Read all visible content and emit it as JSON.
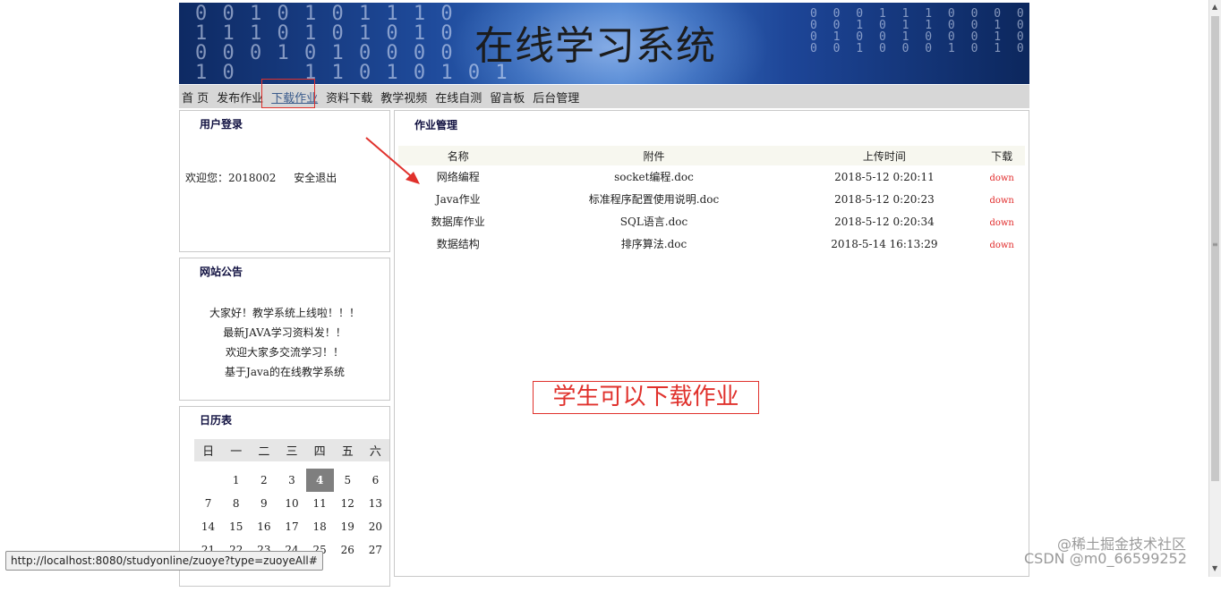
{
  "banner": {
    "title": "在线学习系统",
    "binary_left": "0 0 1 0 1 0 1 1 1 0\n1 1 1 0 1 0 1 0 1 0\n0 0 0 1 0 1 0 0 0 0\n1 0     1 1 0 1 0 1 0 1",
    "binary_right": "0 0 0 1 1 1 0 0 0 0 0 0\n0 0 1 0 1 1 0 0 1 0 1 0 1\n0 1 0 0 1 0 0 0 1 0 1 1\n0 0 1 0 0 0 1 0 1 0 0 1 0 0"
  },
  "nav": {
    "items": [
      "首 页",
      "发布作业",
      "下载作业",
      "资料下载",
      "教学视频",
      "在线自测",
      "留言板",
      "后台管理"
    ],
    "active_index": 2
  },
  "login": {
    "title": "用户登录",
    "welcome": "欢迎您：2018002",
    "logout": "安全退出"
  },
  "notice": {
    "title": "网站公告",
    "items": [
      "大家好！教学系统上线啦！！！",
      "最新JAVA学习资料发！！",
      "欢迎大家多交流学习！！",
      "基于Java的在线教学系统"
    ]
  },
  "calendar": {
    "title": "日历表",
    "weekdays": [
      "日",
      "一",
      "二",
      "三",
      "四",
      "五",
      "六"
    ],
    "weeks": [
      [
        "",
        "1",
        "2",
        "3",
        "4",
        "5",
        "6"
      ],
      [
        "7",
        "8",
        "9",
        "10",
        "11",
        "12",
        "13"
      ],
      [
        "14",
        "15",
        "16",
        "17",
        "18",
        "19",
        "20"
      ],
      [
        "21",
        "22",
        "23",
        "24",
        "25",
        "26",
        "27"
      ]
    ],
    "today": "4"
  },
  "homework": {
    "title": "作业管理",
    "headers": [
      "名称",
      "附件",
      "上传时间",
      "下载"
    ],
    "rows": [
      {
        "name": "网络编程",
        "file": "socket编程.doc",
        "time": "2018-5-12 0:20:11",
        "dl": "down"
      },
      {
        "name": "Java作业",
        "file": "标准程序配置使用说明.doc",
        "time": "2018-5-12 0:20:23",
        "dl": "down"
      },
      {
        "name": "数据库作业",
        "file": "SQL语言.doc",
        "time": "2018-5-12 0:20:34",
        "dl": "down"
      },
      {
        "name": "数据结构",
        "file": "排序算法.doc",
        "time": "2018-5-14 16:13:29",
        "dl": "down"
      }
    ]
  },
  "annotation": {
    "note": "学生可以下载作业",
    "color": "#e0312c"
  },
  "status_bar": "http://localhost:8080/studyonline/zuoye?type=zuoyeAll#",
  "watermark": "@稀土掘金技术社区\nCSDN @m0_66599252"
}
